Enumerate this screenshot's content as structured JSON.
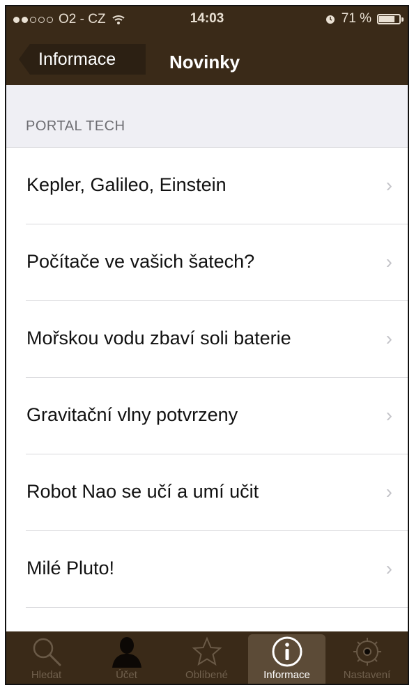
{
  "status_bar": {
    "carrier": "O2 - CZ",
    "time": "14:03",
    "battery": "71 %"
  },
  "nav": {
    "back_label": "Informace",
    "title": "Novinky"
  },
  "section": {
    "header": "PORTAL TECH"
  },
  "items": [
    {
      "label": "Kepler, Galileo, Einstein"
    },
    {
      "label": "Počítače ve vašich šatech?"
    },
    {
      "label": "Mořskou vodu zbaví soli baterie"
    },
    {
      "label": "Gravitační vlny potvrzeny"
    },
    {
      "label": "Robot Nao se učí a umí učit"
    },
    {
      "label": "Milé Pluto!"
    }
  ],
  "tabs": [
    {
      "label": "Hledat",
      "icon": "search-icon"
    },
    {
      "label": "Účet",
      "icon": "person-icon"
    },
    {
      "label": "Oblíbené",
      "icon": "star-icon"
    },
    {
      "label": "Informace",
      "icon": "info-icon",
      "active": true
    },
    {
      "label": "Nastavení",
      "icon": "gear-icon"
    }
  ],
  "colors": {
    "bar_brown": "#3a2a18",
    "active_tab": "#5c4b37",
    "section_bg": "#efeff4"
  }
}
